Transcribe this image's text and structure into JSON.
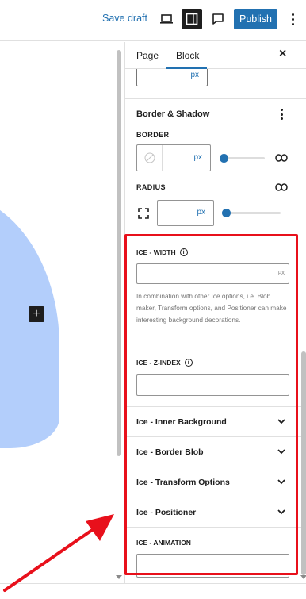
{
  "topbar": {
    "save_draft": "Save draft",
    "publish": "Publish",
    "icons": [
      "desktop-preview-icon",
      "sidebar-toggle-icon",
      "comment-icon",
      "more-options-icon"
    ]
  },
  "canvas": {
    "blob_color": "#b3cefb",
    "add_block": "+"
  },
  "sidebar": {
    "tabs": [
      "Page",
      "Block"
    ],
    "active_tab": "Block",
    "close": "×",
    "partial_unit": "px",
    "border_shadow": {
      "title": "Border & Shadow",
      "border_label": "BORDER",
      "border_unit": "px",
      "radius_label": "RADIUS",
      "radius_unit": "px"
    },
    "ice_width": {
      "label": "ICE - WIDTH",
      "unit": "PX",
      "help": "In combination with other Ice options, i.e. Blob maker, Transform options, and Positioner can make interesting background decorations."
    },
    "ice_zindex": {
      "label": "ICE - Z-INDEX"
    },
    "accordions": [
      "Ice - Inner Background",
      "Ice - Border Blob",
      "Ice - Transform Options",
      "Ice - Positioner"
    ],
    "ice_animation": {
      "label": "ICE - ANIMATION"
    }
  },
  "colors": {
    "accent": "#2271b1",
    "highlight": "#e8101b"
  }
}
